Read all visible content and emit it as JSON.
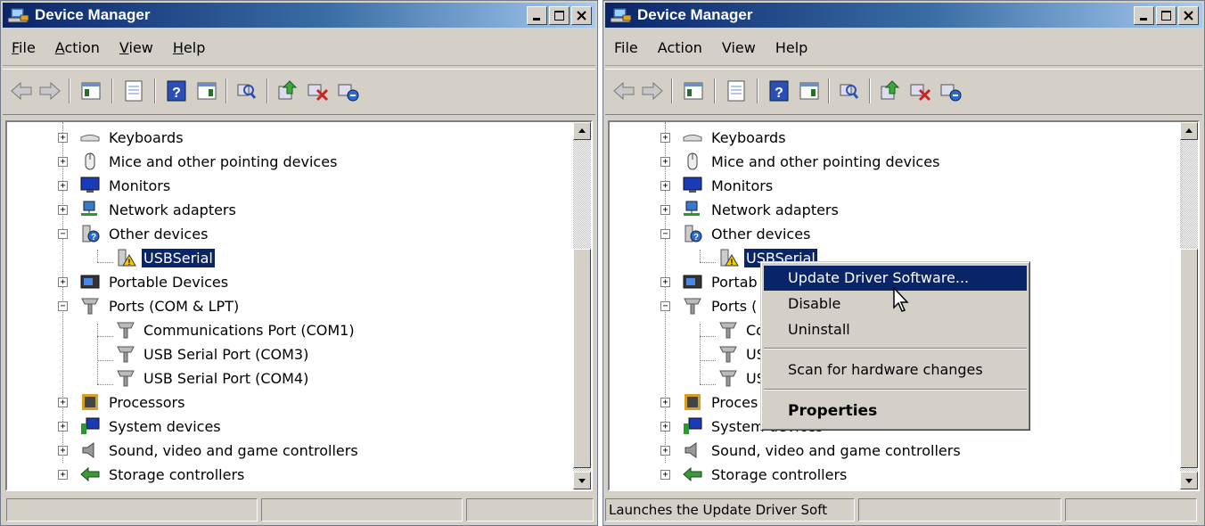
{
  "window_title": "Device Manager",
  "menus": [
    {
      "label": "File",
      "accel": "F",
      "rest": "ile"
    },
    {
      "label": "Action",
      "accel": "A",
      "rest": "ction"
    },
    {
      "label": "View",
      "accel": "V",
      "rest": "iew"
    },
    {
      "label": "Help",
      "accel": "H",
      "rest": "elp"
    }
  ],
  "toolbar_icons": [
    "back-icon",
    "forward-icon",
    "show-hide-console-tree-icon",
    "properties-icon",
    "help-icon",
    "action-pane-icon",
    "scan-hardware-icon",
    "update-driver-icon",
    "uninstall-icon",
    "disable-icon"
  ],
  "tree": {
    "keyboards": "Keyboards",
    "mice": "Mice and other pointing devices",
    "monitors": "Monitors",
    "network": "Network adapters",
    "other": "Other devices",
    "usbserial": "USBSerial",
    "portable": "Portable Devices",
    "ports": "Ports (COM & LPT)",
    "com1": "Communications Port (COM1)",
    "com3": "USB Serial Port (COM3)",
    "com4": "USB Serial Port (COM4)",
    "processors": "Processors",
    "system": "System devices",
    "sound": "Sound, video and game controllers",
    "storage": "Storage controllers"
  },
  "tree_right_truncated": {
    "usbserial": "USBSerial",
    "portable": "Portab",
    "ports": "Ports (",
    "com1": "Co",
    "com3": "US",
    "com4": "US",
    "processors": "Proces"
  },
  "context_menu": {
    "update": "Update Driver Software...",
    "disable": "Disable",
    "uninstall": "Uninstall",
    "scan": "Scan for hardware changes",
    "properties": "Properties"
  },
  "status_right": "Launches the Update Driver Soft",
  "colors": {
    "title_start": "#0a246a",
    "title_end": "#a6caf0",
    "selection": "#0a246a",
    "face": "#d4d0c8"
  }
}
